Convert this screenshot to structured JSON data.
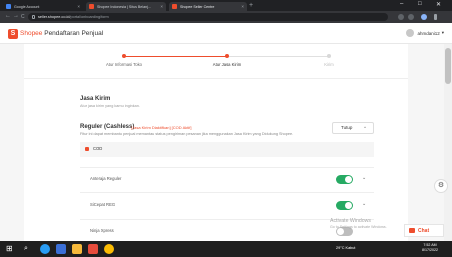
{
  "browser": {
    "tabs": [
      {
        "label": "Google Account"
      },
      {
        "label": "Shopee Indonesia | Situs Belanj..."
      },
      {
        "label": "Shopee Seller Centre"
      }
    ],
    "new_tab": "+",
    "window_controls": {
      "minimize": "–",
      "maximize": "□",
      "close": "✕"
    },
    "nav": {
      "back": "←",
      "forward": "→",
      "reload": "C"
    },
    "url_host": "seller.shopee.co.id",
    "url_path": "/portal/onboarding/form"
  },
  "header": {
    "logo_letter": "S",
    "brand": "Shopee",
    "subtitle": "Pendaftaran Penjual",
    "username": "ahmdani12",
    "user_chevron": "▾"
  },
  "stepper": {
    "steps": [
      {
        "label": "Atur Informasi Toko",
        "state": "done"
      },
      {
        "label": "Atur Jasa Kirim",
        "state": "active"
      },
      {
        "label": "Kirim",
        "state": "pending"
      }
    ],
    "active_color": "#ee4d2d",
    "pending_color": "#d8d8d8"
  },
  "section": {
    "title": "Jasa Kirim",
    "description": "Atur jasa kirim yang kamu inginkan."
  },
  "reguler": {
    "title": "Reguler (Cashless)",
    "tag": "[Jasa Kirim Diaktifkan] [COD Aktif]",
    "description": "Fitur ini dapat membantu penjual memantau status pengiriman pesanan jika menggunakan Jasa Kirim yang Didukung Shopee.",
    "toggle_label": "Tutup",
    "toggle_chevron": "^",
    "cod_label": "COD"
  },
  "couriers": [
    {
      "name": "Anteraja Reguler",
      "enabled": true
    },
    {
      "name": "SiCepat REG",
      "enabled": true
    },
    {
      "name": "Ninja Xpress",
      "enabled": false
    }
  ],
  "colors": {
    "brand": "#ee4d2d",
    "toggle_on": "#26aa63",
    "toggle_off": "#bdbdbd"
  },
  "overlay": {
    "activate_title": "Activate Windows",
    "activate_sub": "Go to Settings to activate Windows.",
    "chat_label": "Chat"
  },
  "taskbar": {
    "weather": "29°C Kabut",
    "time": "7:52 AM",
    "date": "8/17/2022"
  }
}
